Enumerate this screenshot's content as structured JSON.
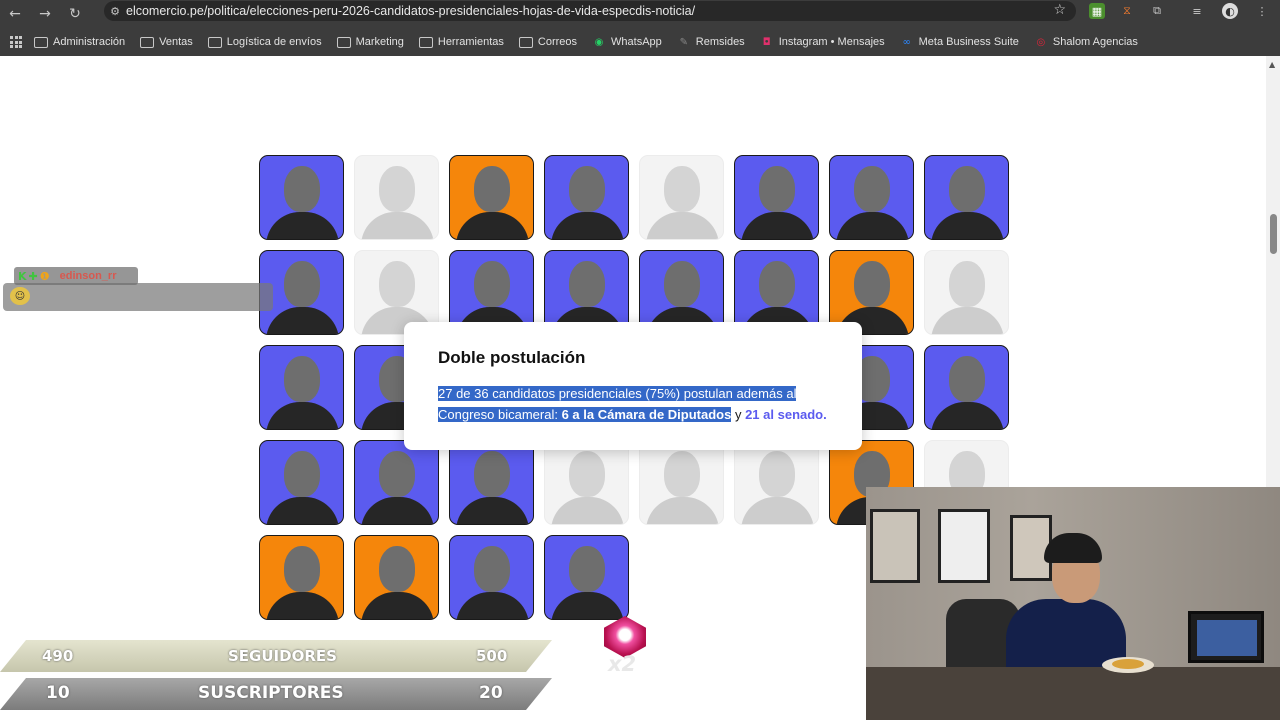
{
  "browser": {
    "url": "elcomercio.pe/politica/elecciones-peru-2026-candidatos-presidenciales-hojas-de-vida-especdis-noticia/",
    "back_icon": "←",
    "forward_icon": "→",
    "reload_icon": "↻",
    "star_icon": "☆",
    "tune_icon": "⚙",
    "bookmarks": [
      {
        "label": "Administración",
        "icon": "folder"
      },
      {
        "label": "Ventas",
        "icon": "folder"
      },
      {
        "label": "Logística de envíos",
        "icon": "folder"
      },
      {
        "label": "Marketing",
        "icon": "folder"
      },
      {
        "label": "Herramientas",
        "icon": "folder"
      },
      {
        "label": "Correos",
        "icon": "folder"
      },
      {
        "label": "WhatsApp",
        "icon": "whatsapp"
      },
      {
        "label": "Remsides",
        "icon": "remsides"
      },
      {
        "label": "Instagram • Mensajes",
        "icon": "instagram"
      },
      {
        "label": "Meta Business Suite",
        "icon": "meta"
      },
      {
        "label": "Shalom Agencias",
        "icon": "shalom"
      }
    ]
  },
  "candidates_grid": {
    "rows": [
      [
        "blue",
        "gray",
        "orange",
        "blue",
        "gray",
        "blue",
        "blue",
        "blue"
      ],
      [
        "blue",
        "gray",
        "blue",
        "blue",
        "blue",
        "blue",
        "orange",
        "gray"
      ],
      [
        "blue",
        "blue",
        "hidden",
        "hidden",
        "hidden",
        "hidden",
        "blue",
        "blue"
      ],
      [
        "blue",
        "blue",
        "blue",
        "gray",
        "gray",
        "gray",
        "orange",
        "gray"
      ],
      [
        "orange",
        "orange",
        "blue",
        "blue"
      ]
    ]
  },
  "popup": {
    "title": "Doble postulación",
    "text_selected_1": "27 de 36 candidatos presidenciales (75%) postulan además al Congreso bicameral: ",
    "bold_selected": "6 a la Cámara de Diputados",
    "text_plain": " y ",
    "bold_purple": "21 al senado."
  },
  "stream": {
    "chat_user": "edinson_rr",
    "chat_badges": [
      "K",
      "✚",
      "❶"
    ],
    "stat1": {
      "left": "490",
      "label": "SEGUIDORES",
      "right": "500"
    },
    "stat2": {
      "left": "10",
      "label": "SUSCRIPTORES",
      "right": "20"
    },
    "multiplier": "x2"
  },
  "colors": {
    "blue_card": "#5b5bef",
    "orange_card": "#f5860b",
    "gray_card": "#f3f3f3",
    "selection": "#3468c8",
    "accent_purple": "#5b5bef"
  }
}
